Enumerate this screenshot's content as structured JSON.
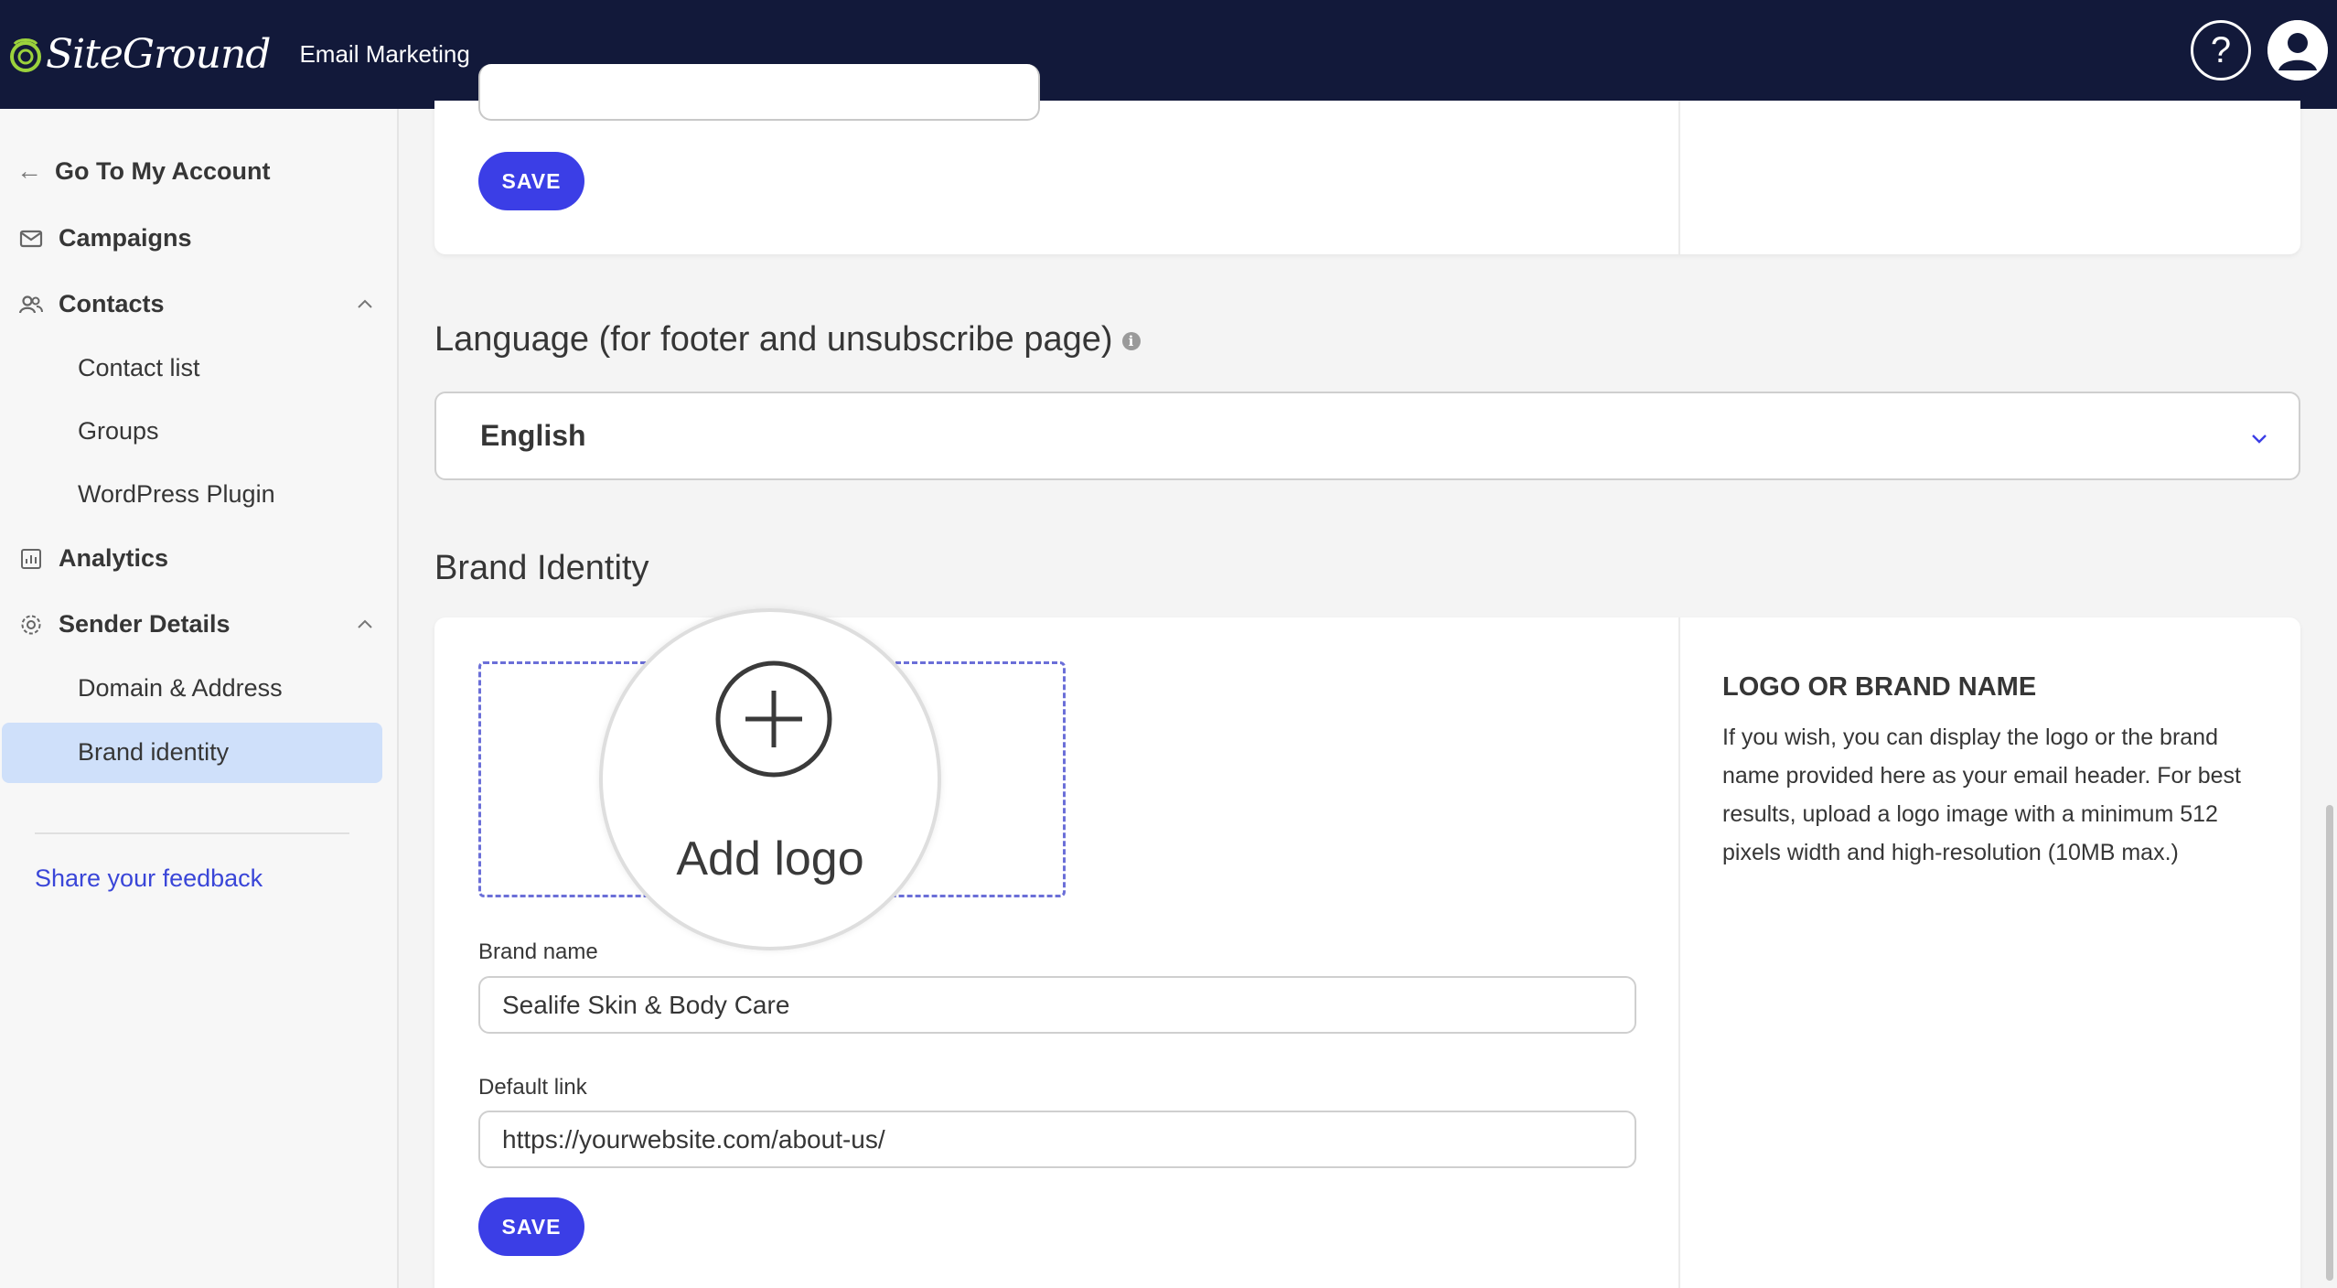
{
  "header": {
    "brand": "SiteGround",
    "product": "Email Marketing",
    "help_symbol": "?"
  },
  "sidebar": {
    "back_label": "Go To My Account",
    "items": [
      {
        "label": "Campaigns",
        "icon": "envelope-icon"
      },
      {
        "label": "Contacts",
        "icon": "users-icon",
        "expanded": true
      },
      {
        "label": "Analytics",
        "icon": "bar-chart-icon"
      },
      {
        "label": "Sender Details",
        "icon": "gear-icon",
        "expanded": true
      }
    ],
    "contacts_sub": [
      "Contact list",
      "Groups",
      "WordPress Plugin"
    ],
    "sender_sub": [
      "Domain & Address",
      "Brand identity"
    ],
    "active_item": "Brand identity",
    "feedback_label": "Share your feedback"
  },
  "top_section": {
    "save_label": "SAVE"
  },
  "language": {
    "title": "Language (for footer and unsubscribe page)",
    "info_symbol": "i",
    "selected": "English"
  },
  "brand_identity": {
    "title": "Brand Identity",
    "add_logo_label": "Add logo",
    "brand_name_label": "Brand name",
    "brand_name_value": "Sealife Skin & Body Care",
    "default_link_label": "Default link",
    "default_link_value": "https://yourwebsite.com/about-us/",
    "save_label": "SAVE",
    "aside_title": "LOGO OR BRAND NAME",
    "aside_text": "If you wish, you can display the logo or the brand name provided here as your email header. For best results, upload a logo image with a minimum 512 pixels width and high-resolution (10MB max.)"
  },
  "colors": {
    "topbar": "#12193a",
    "accent": "#3b3ee6",
    "active_nav_bg": "#cfe0fa",
    "link": "#3a46d8"
  }
}
